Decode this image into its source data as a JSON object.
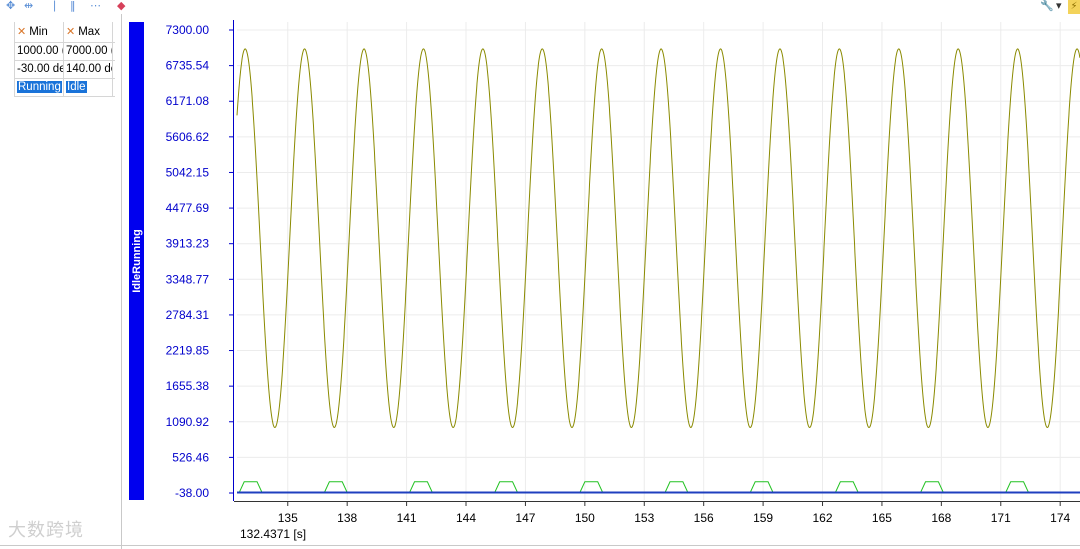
{
  "toolbar": {
    "icons": [
      "fit-horizontal-icon",
      "fit-vertical-icon",
      "single-cursor-icon",
      "double-cursor-icon",
      "more-icon",
      "eraser-icon"
    ],
    "right_icons": [
      "wrench-icon",
      "dropdown-icon",
      "flash-icon"
    ]
  },
  "signal_table": {
    "headers": [
      "Min",
      "Max"
    ],
    "rows": [
      [
        "1000.00 (",
        "7000.00 ("
      ],
      [
        "-30.00 de",
        "140.00 de"
      ]
    ],
    "state_row": [
      "Running",
      "Idle"
    ]
  },
  "axis_band_label": "IdleRunning",
  "cursor_readout": "132.4371 [s]",
  "watermark": "大数跨境",
  "colors": {
    "primary_trace": "#8a8a00",
    "secondary_trace": "#22c222",
    "baseline_trace": "#1f3fbf",
    "axis_labels": "#0000cc",
    "axis_band": "#0000ee"
  },
  "chart_data": {
    "type": "line",
    "title": "",
    "xlabel": "",
    "ylabel": "",
    "xlim": [
      132.4371,
      175
    ],
    "ylim": [
      -38.0,
      7300.0
    ],
    "y_ticks": [
      7300.0,
      6735.54,
      6171.08,
      5606.62,
      5042.15,
      4477.69,
      3913.23,
      3348.77,
      2784.31,
      2219.85,
      1655.38,
      1090.92,
      526.46,
      -38.0
    ],
    "y_tick_labels": [
      "7300.00",
      "6735.54",
      "6171.08",
      "5606.62",
      "5042.15",
      "4477.69",
      "3913.23",
      "3348.77",
      "2784.31",
      "2219.85",
      "1655.38",
      "1090.92",
      "526.46",
      "-38.00"
    ],
    "x_ticks": [
      135,
      138,
      141,
      144,
      147,
      150,
      153,
      156,
      159,
      162,
      165,
      168,
      171,
      174
    ],
    "x_tick_labels": [
      "135",
      "138",
      "141",
      "144",
      "147",
      "150",
      "153",
      "156",
      "159",
      "162",
      "165",
      "168",
      "171",
      "174"
    ],
    "grid": true,
    "series": [
      {
        "style": "sine",
        "color": "#8a8a00",
        "min": 1000.0,
        "max": 7000.0,
        "period": 3.0,
        "first_peak": 132.85
      },
      {
        "style": "trapezoid",
        "color": "#22c222",
        "low": -30.0,
        "high": 140.0,
        "period": 4.3,
        "first_rise": 132.55
      },
      {
        "style": "flat",
        "color": "#1f3fbf",
        "value": -30.0
      }
    ]
  }
}
